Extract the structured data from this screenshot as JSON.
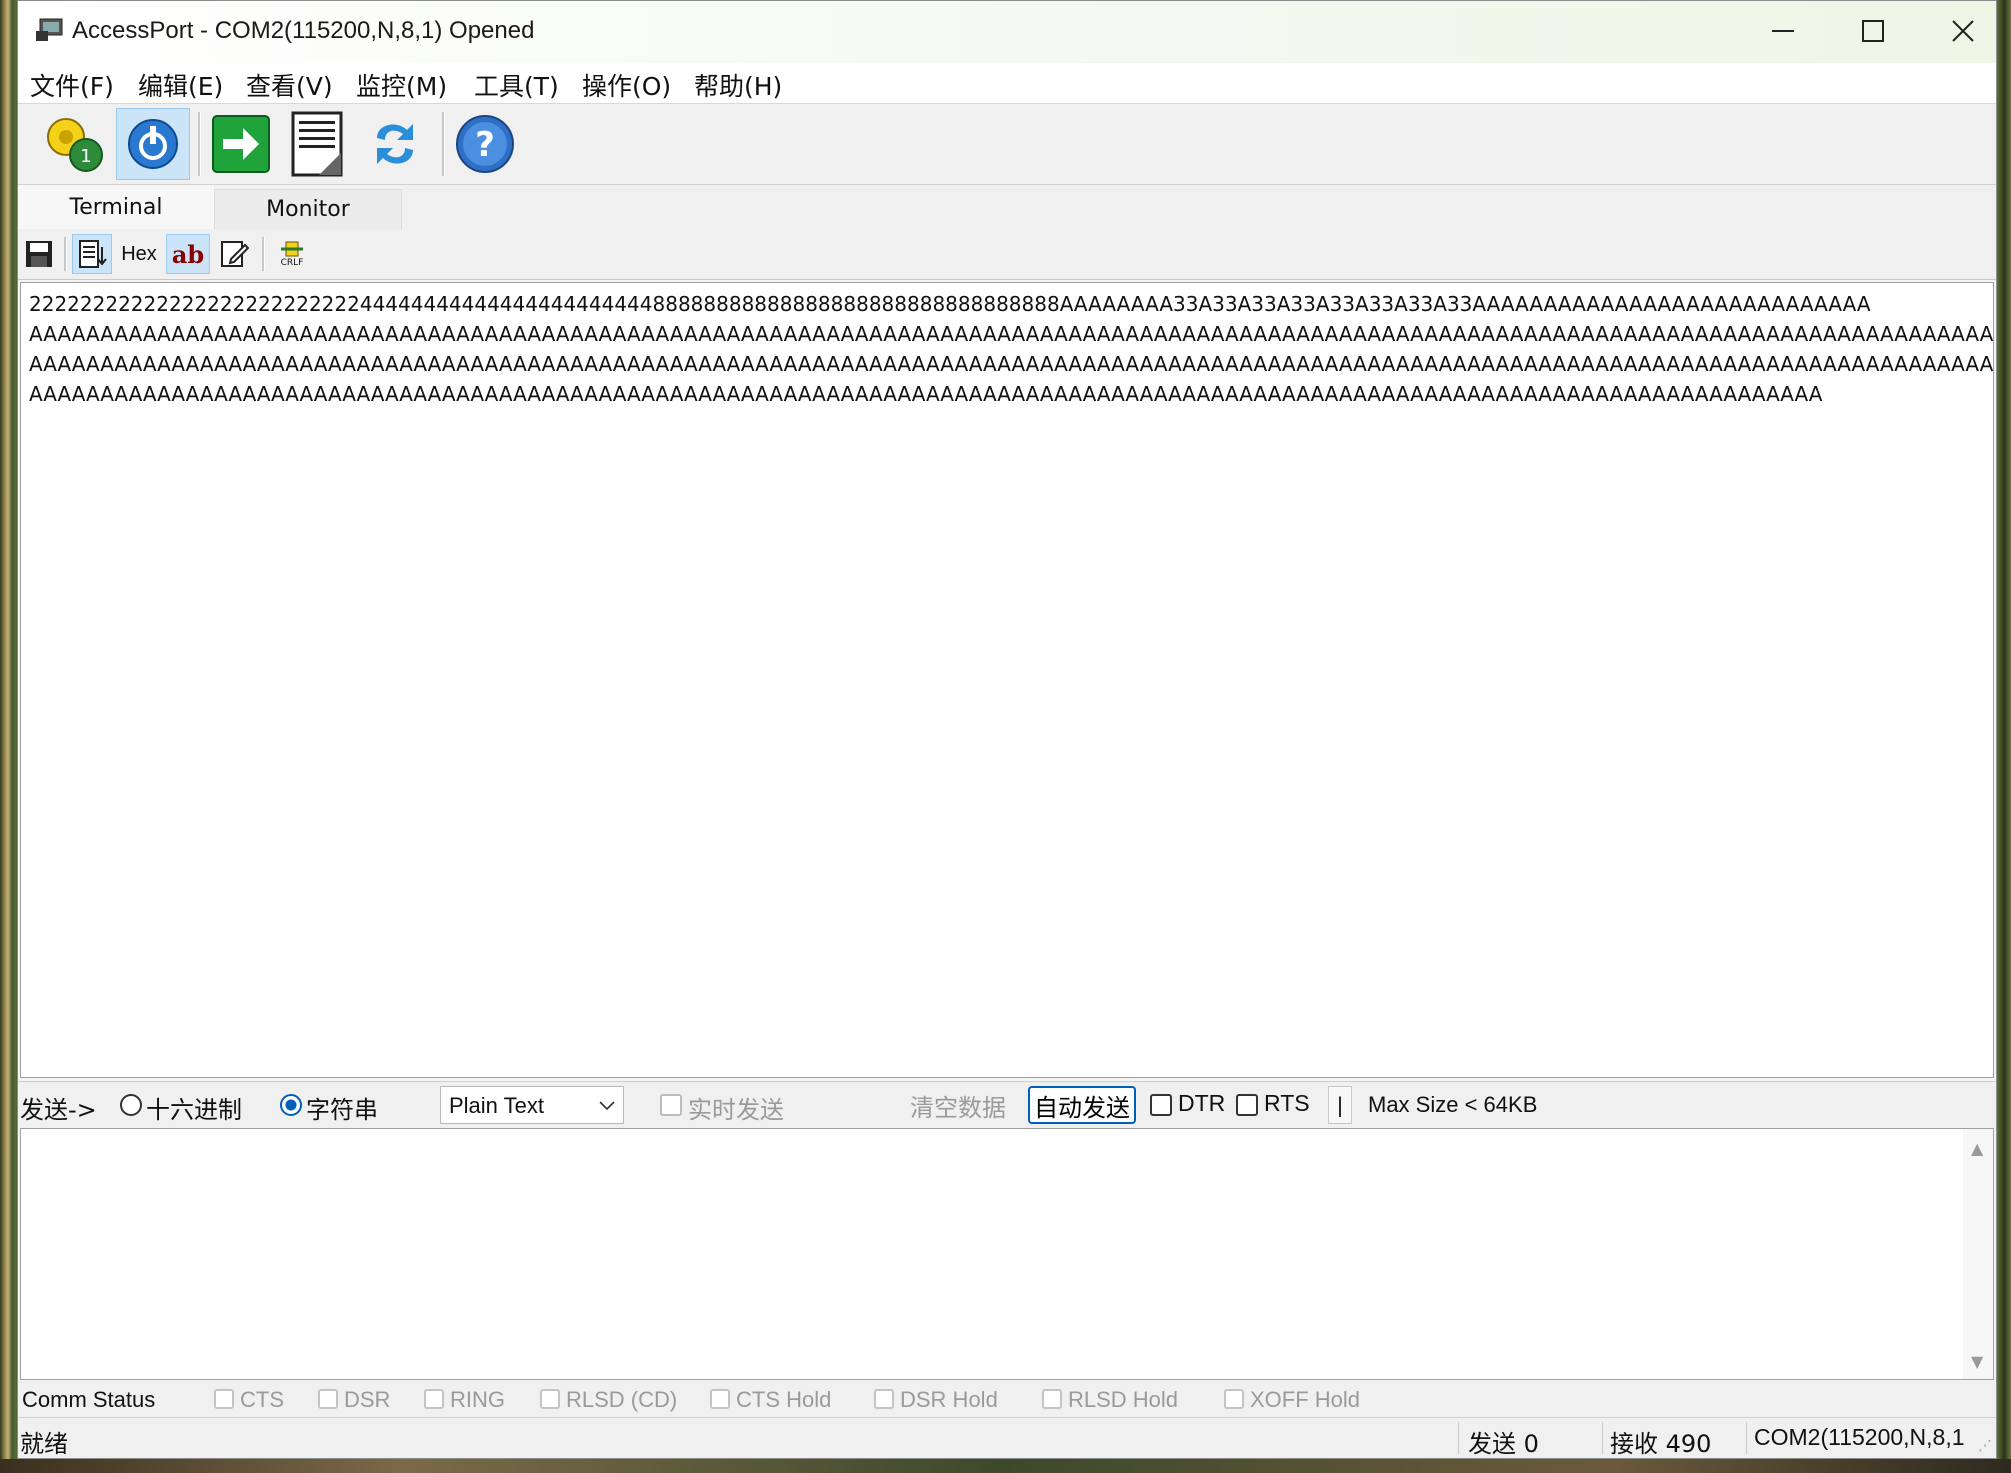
{
  "window": {
    "title": "AccessPort - COM2(115200,N,8,1) Opened"
  },
  "menu": [
    "文件(F)",
    "编辑(E)",
    "查看(V)",
    "监控(M)",
    "工具(T)",
    "操作(O)",
    "帮助(H)"
  ],
  "toolbar": {
    "icons": [
      "settings-gear-icon",
      "power-icon",
      "send-arrow-icon",
      "document-icon",
      "refresh-swap-icon",
      "help-icon"
    ]
  },
  "tabs": [
    {
      "label": "Terminal",
      "selected": true
    },
    {
      "label": "Monitor",
      "selected": false
    }
  ],
  "subtoolbar": {
    "hex_label": "Hex",
    "ab_label": "ab",
    "crlf_label": "CRLF"
  },
  "terminal": {
    "lines": [
      "222222222222222222222222224444444444444444444444488888888888888888888888888888888AAAAAAAA33A33A33A33A33A33A33A33AAAAAAAAAAAAAAAAAAAAAAAAAAAA",
      "AAAAAAAAAAAAAAAAAAAAAAAAAAAAAAAAAAAAAAAAAAAAAAAAAAAAAAAAAAAAAAAAAAAAAAAAAAAAAAAAAAAAAAAAAAAAAAAAAAAAAAAAAAAAAAAAAAAAAAAAAAAAAAAAAAAAAAAAAAAA",
      "AAAAAAAAAAAAAAAAAAAAAAAAAAAAAAAAAAAAAAAAAAAAAAAAAAAAAAAAAAAAAAAAAAAAAAAAAAAAAAAAAAAAAAAAAAAAAAAAAAAAAAAAAAAAAAAAAAAAAAAAAAAAAAAAAAAAAAAAAAAA",
      "AAAAAAAAAAAAAAAAAAAAAAAAAAAAAAAAAAAAAAAAAAAAAAAAAAAAAAAAAAAAAAAAAAAAAAAAAAAAAAAAAAAAAAAAAAAAAAAAAAAAAAAAAAAAAAAAAAAAAAAAAAAAAA"
    ]
  },
  "sendbar": {
    "send_label": "发送->",
    "radio_hex": "十六进制",
    "radio_string": "字符串",
    "format_value": "Plain Text",
    "realtime_label": "实时发送",
    "clear_label": "清空数据",
    "auto_send_label": "自动发送",
    "dtr_label": "DTR",
    "rts_label": "RTS",
    "narrow_btn_label": "|",
    "max_size_label": "Max Size < 64KB"
  },
  "comm_status": {
    "label": "Comm Status",
    "items": [
      "CTS",
      "DSR",
      "RING",
      "RLSD (CD)",
      "CTS Hold",
      "DSR Hold",
      "RLSD Hold",
      "XOFF Hold"
    ]
  },
  "statusbar": {
    "ready": "就绪",
    "sent": "发送 0",
    "received": "接收 490",
    "port": "COM2(115200,N,8,1"
  }
}
